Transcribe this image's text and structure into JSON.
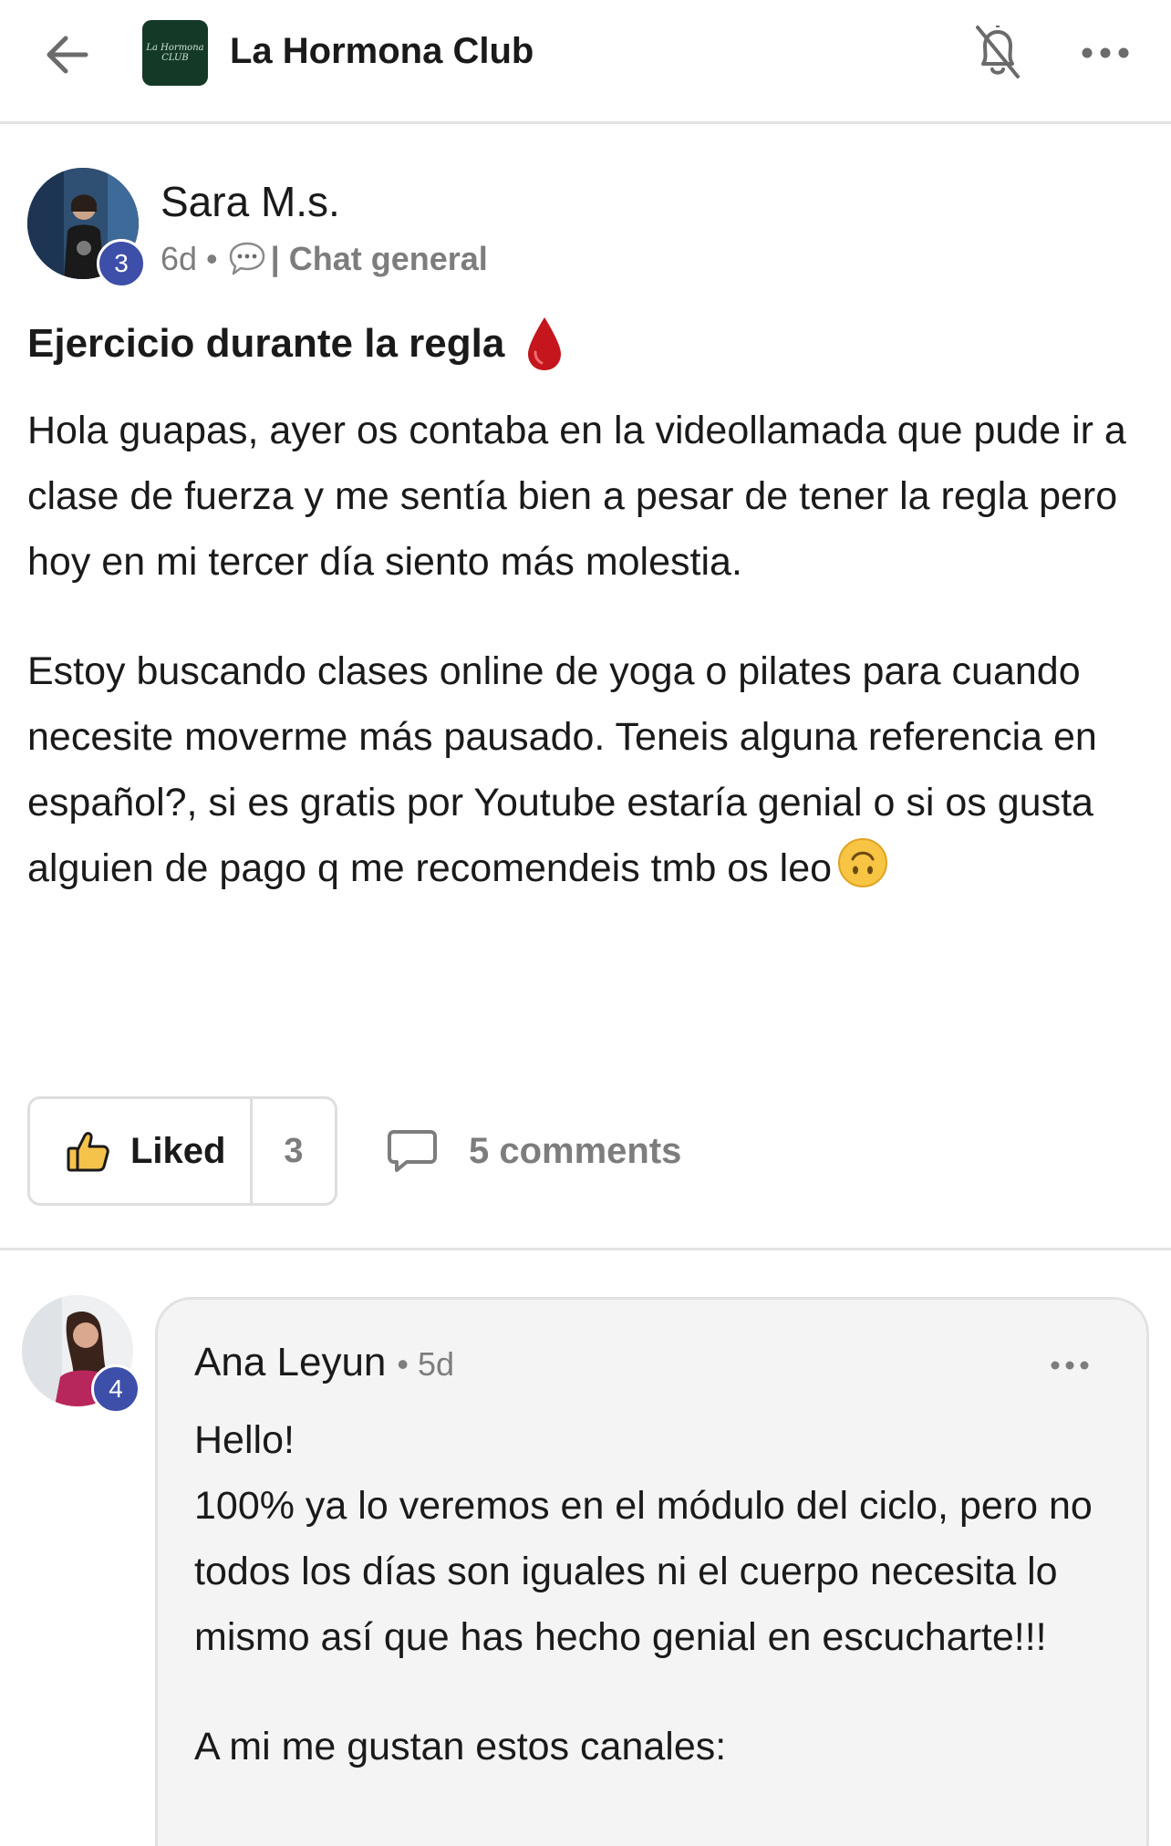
{
  "header": {
    "club_name": "La Hormona Club",
    "logo_text_line1": "La Hormona",
    "logo_text_line2": "CLUB",
    "icons": [
      "back-arrow-icon",
      "bell-off-icon",
      "more-horizontal-icon"
    ]
  },
  "post": {
    "author": "Sara M.s.",
    "level_badge": "3",
    "time": "6d",
    "separator": "•",
    "channel": "| Chat general",
    "title": "Ejercicio durante la regla",
    "paragraphs": [
      "Hola guapas, ayer os contaba en la videollamada que pude ir a clase de fuerza y me sentía bien a pesar de tener la regla pero hoy en mi tercer día siento más molestia.",
      "Estoy buscando clases online de yoga o pilates para cuando necesite moverme más pausado. Teneis alguna referencia en español?, si es gratis por Youtube estaría genial o si os gusta alguien de pago q me recomendeis tmb os leo"
    ],
    "like_label": "Liked",
    "like_count": "3",
    "comments_label": "5 comments"
  },
  "comment": {
    "author": "Ana Leyun",
    "time": "• 5d",
    "level_badge": "4",
    "paragraphs": [
      "Hello!\n100% ya lo veremos en el módulo del ciclo, pero no todos los días son iguales ni el cuerpo necesita lo mismo así que has hecho genial en escucharte!!!",
      "A mi me gustan estos canales:"
    ]
  },
  "colors": {
    "badge": "#3d4fa8",
    "logo_bg": "#143a27",
    "muted_text": "#7d7d7d",
    "comment_bg": "#f4f4f4",
    "drop_red": "#c4161c"
  }
}
